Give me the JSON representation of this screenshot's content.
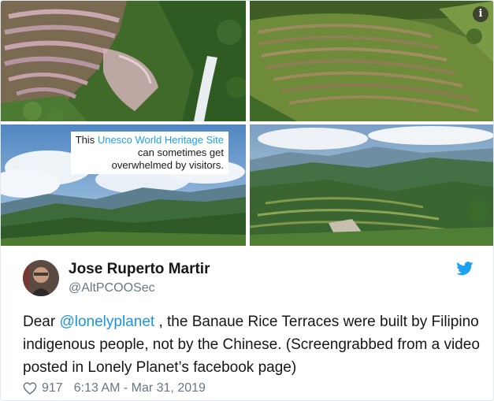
{
  "media": {
    "caption": {
      "line1_prefix": "This",
      "line1_highlight": "Unesco World Heritage Site",
      "line2": "can sometimes get",
      "line3": "overwhelmed by visitors."
    },
    "info_icon": "i"
  },
  "tweet": {
    "author_name": "Jose Ruperto Martir",
    "author_handle": "@AltPCOOSec",
    "text_prefix": "Dear ",
    "mention": "@lonelyplanet",
    "text_rest": " , the Banaue Rice Terraces were built by Filipino indigenous people, not by the Chinese. (Screengrabbed from a video posted in Lonely Planet’s facebook page)",
    "likes": "917",
    "timestamp": "6:13 AM - Mar 31, 2019"
  },
  "icons": {
    "brand": "twitter-bird-icon",
    "like": "heart-icon",
    "info": "info-icon"
  },
  "colors": {
    "link": "#1b95e0",
    "brand": "#1da1f2",
    "secondary_text": "#657786"
  }
}
